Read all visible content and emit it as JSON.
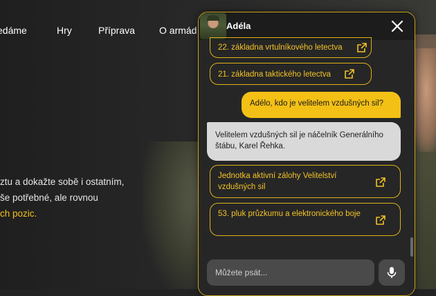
{
  "nav": {
    "items": [
      "edáme",
      "Hry",
      "Příprava",
      "O armád"
    ]
  },
  "hero": {
    "line1": "ztu a dokažte sobě i ostatním,",
    "line2": "še potřebné, ale rovnou",
    "line3_accent": "ch pozic."
  },
  "chat": {
    "agent_name": "Adéla",
    "icons": {
      "close": "close-icon",
      "external": "external-link-icon",
      "mic": "microphone-icon"
    },
    "accent_color": "#f3c015",
    "messages": {
      "link1": "22. základna vrtulníkového letectva",
      "link2": "21. základna taktického letectva",
      "user_question": "Adélo, kdo je velitelem vzdušných sil?",
      "bot_answer": "Velitelem vzdušných sil je náčelník Generálního štábu, Karel Řehka.",
      "link3": "Jednotka aktivní zálohy Velitelství vzdušných sil",
      "link4": "53. pluk průzkumu a elektronického boje"
    },
    "input": {
      "placeholder": "Můžete psát..."
    }
  }
}
